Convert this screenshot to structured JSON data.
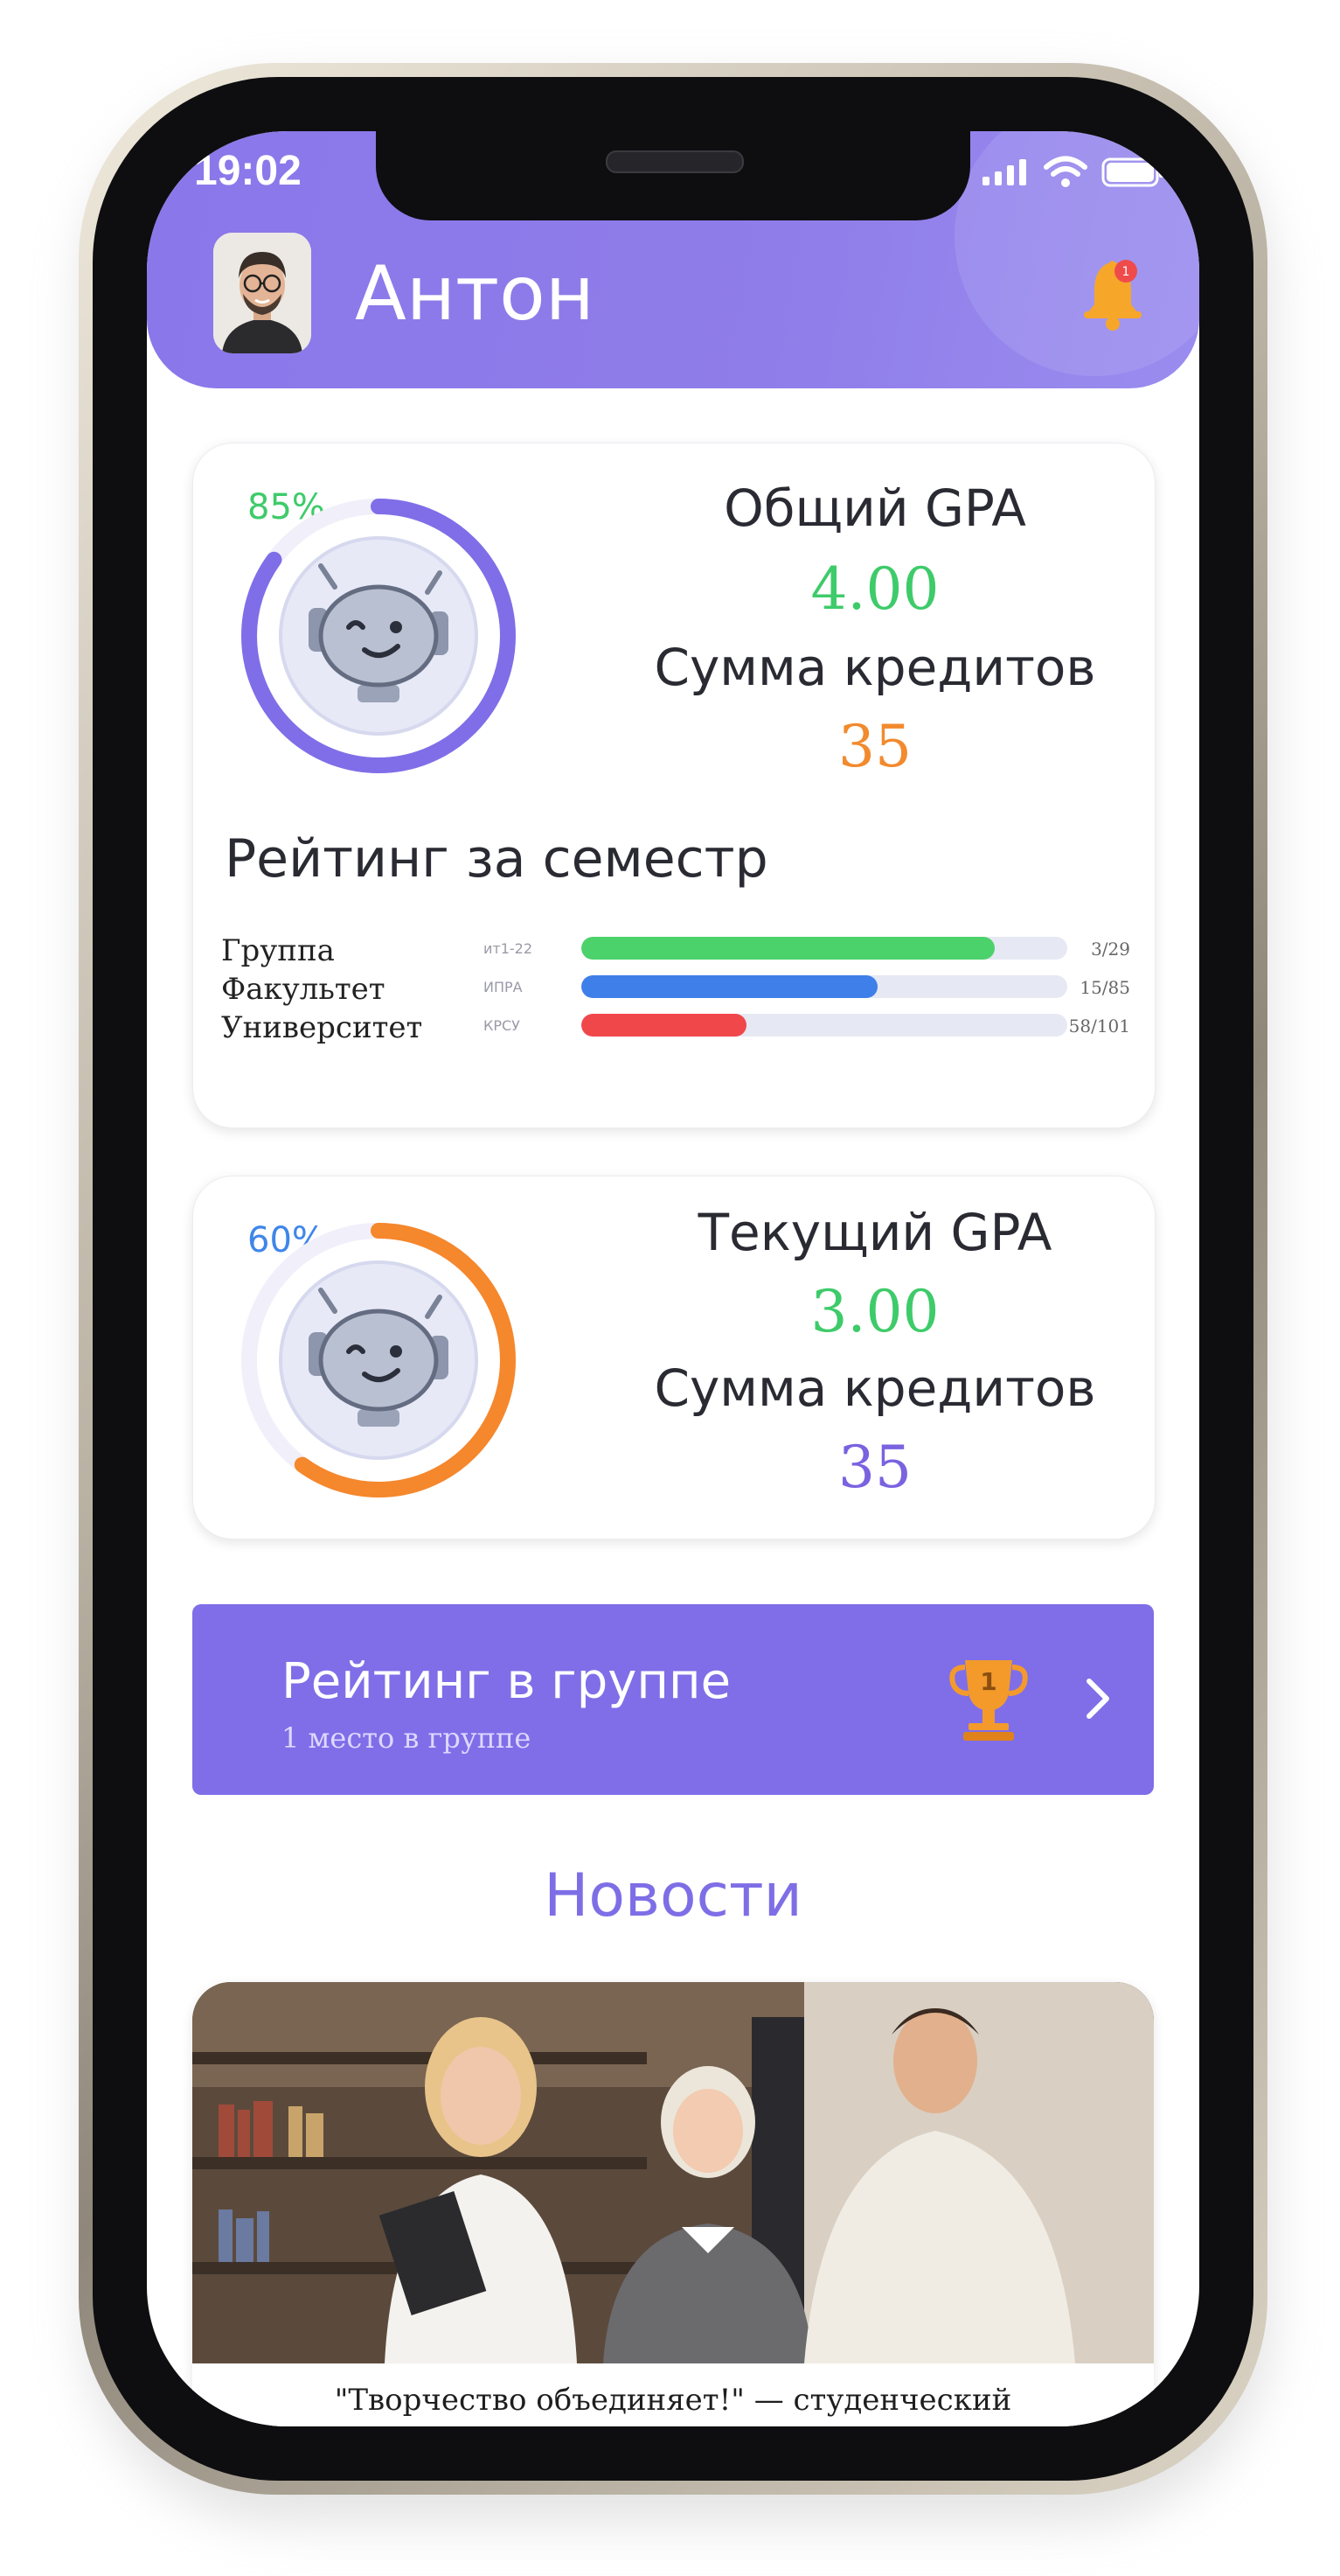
{
  "status_bar": {
    "time": "19:02"
  },
  "header": {
    "username": "Антон",
    "notification_count": "1"
  },
  "overall_card": {
    "percent_label": "85%",
    "progress": 0.85,
    "gpa_title": "Общий GPA",
    "gpa_value": "4.00",
    "credits_title": "Сумма кредитов",
    "credits_value": "35",
    "colors": {
      "ring": "#7f6ee8",
      "percent": "#3ecb6a",
      "gpa": "#3ecb6a",
      "credits": "#f28a2e"
    }
  },
  "semester_rating": {
    "title": "Рейтинг за семестр",
    "rows": [
      {
        "label": "Группа",
        "code": "ит1-22",
        "fill": 0.85,
        "position": "3/29",
        "color": "#4cd26a"
      },
      {
        "label": "Факультет",
        "code": "ИПРА",
        "fill": 0.61,
        "position": "15/85",
        "color": "#3f7fe9"
      },
      {
        "label": "Университет",
        "code": "КРСУ",
        "fill": 0.34,
        "position": "58/101",
        "color": "#f0474b"
      }
    ]
  },
  "current_card": {
    "percent_label": "60%",
    "progress": 0.6,
    "gpa_title": "Текущий GPA",
    "gpa_value": "3.00",
    "credits_title": "Сумма кредитов",
    "credits_value": "35",
    "colors": {
      "ring": "#f5872c",
      "percent": "#3f86e9",
      "gpa": "#3ecb6a",
      "credits": "#7a62e0"
    }
  },
  "group_rating_banner": {
    "title": "Рейтинг в группе",
    "subtitle": "1 место в группе",
    "trophy_number": "1",
    "icons": {
      "trophy": "trophy-icon",
      "chevron": "chevron-right-icon"
    }
  },
  "news": {
    "title": "Новости",
    "items": [
      {
        "caption": "\"Творчество объединяет!\" — студенческий"
      }
    ]
  }
}
